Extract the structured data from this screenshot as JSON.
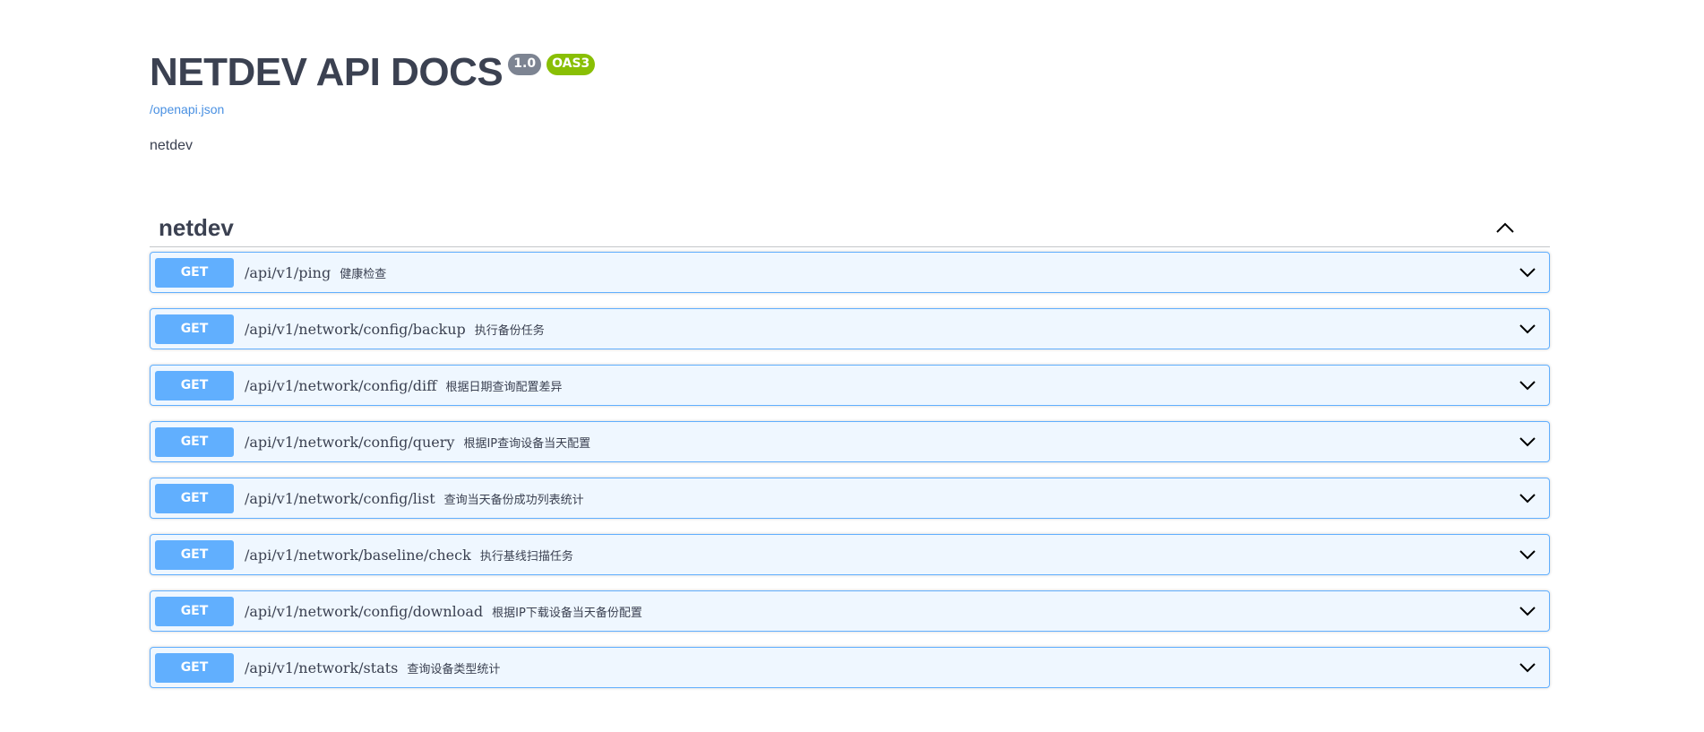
{
  "info": {
    "title": "NETDEV API DOCS",
    "version": "1.0",
    "oas": "OAS3",
    "spec_link": "/openapi.json",
    "description": "netdev"
  },
  "tag": {
    "name": "netdev",
    "expanded": true,
    "toggle_icon": "chevron-up-icon"
  },
  "colors": {
    "get_method": "#61affe",
    "version_badge": "#7d8492",
    "oas_badge": "#89bf04",
    "link": "#4990e2",
    "text": "#3b4151"
  },
  "operations": [
    {
      "method": "GET",
      "path": "/api/v1/ping",
      "summary": "健康检查"
    },
    {
      "method": "GET",
      "path": "/api/v1/network/config/backup",
      "summary": "执行备份任务"
    },
    {
      "method": "GET",
      "path": "/api/v1/network/config/diff",
      "summary": "根据日期查询配置差异"
    },
    {
      "method": "GET",
      "path": "/api/v1/network/config/query",
      "summary": "根据IP查询设备当天配置"
    },
    {
      "method": "GET",
      "path": "/api/v1/network/config/list",
      "summary": "查询当天备份成功列表统计"
    },
    {
      "method": "GET",
      "path": "/api/v1/network/baseline/check",
      "summary": "执行基线扫描任务"
    },
    {
      "method": "GET",
      "path": "/api/v1/network/config/download",
      "summary": "根据IP下载设备当天备份配置"
    },
    {
      "method": "GET",
      "path": "/api/v1/network/stats",
      "summary": "查询设备类型统计"
    }
  ]
}
